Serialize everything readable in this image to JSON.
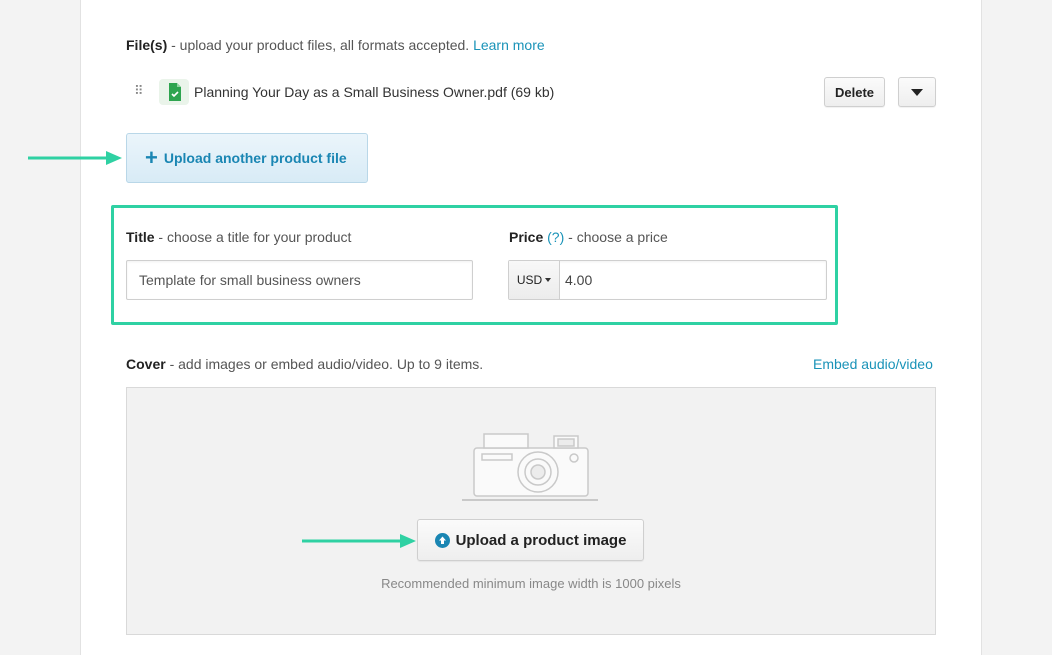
{
  "files": {
    "label_bold": "File(s)",
    "label_rest": " - upload your product files, all formats accepted.",
    "learn_more": "Learn more",
    "drag_handle": "⠿",
    "items": [
      {
        "name": "Planning Your Day as a Small Business Owner.pdf (69 kb)",
        "icon": "pdf-file-icon"
      }
    ],
    "delete_label": "Delete",
    "upload_another_label": "Upload another product file"
  },
  "title": {
    "label_bold": "Title",
    "label_rest": " - choose a title for your product",
    "value": "Template for small business owners"
  },
  "price": {
    "label_bold": "Price",
    "help": "(?)",
    "label_rest": " - choose a price",
    "currency": "USD",
    "value": "4.00"
  },
  "cover": {
    "label_bold": "Cover",
    "label_rest": " - add images or embed audio/video. Up to 9 items.",
    "embed_link": "Embed audio/video",
    "upload_label": "Upload a product image",
    "recommendation": "Recommended minimum image width is 1000 pixels"
  },
  "colors": {
    "accent_link": "#1a93b8",
    "highlight": "#2fd1a3"
  }
}
